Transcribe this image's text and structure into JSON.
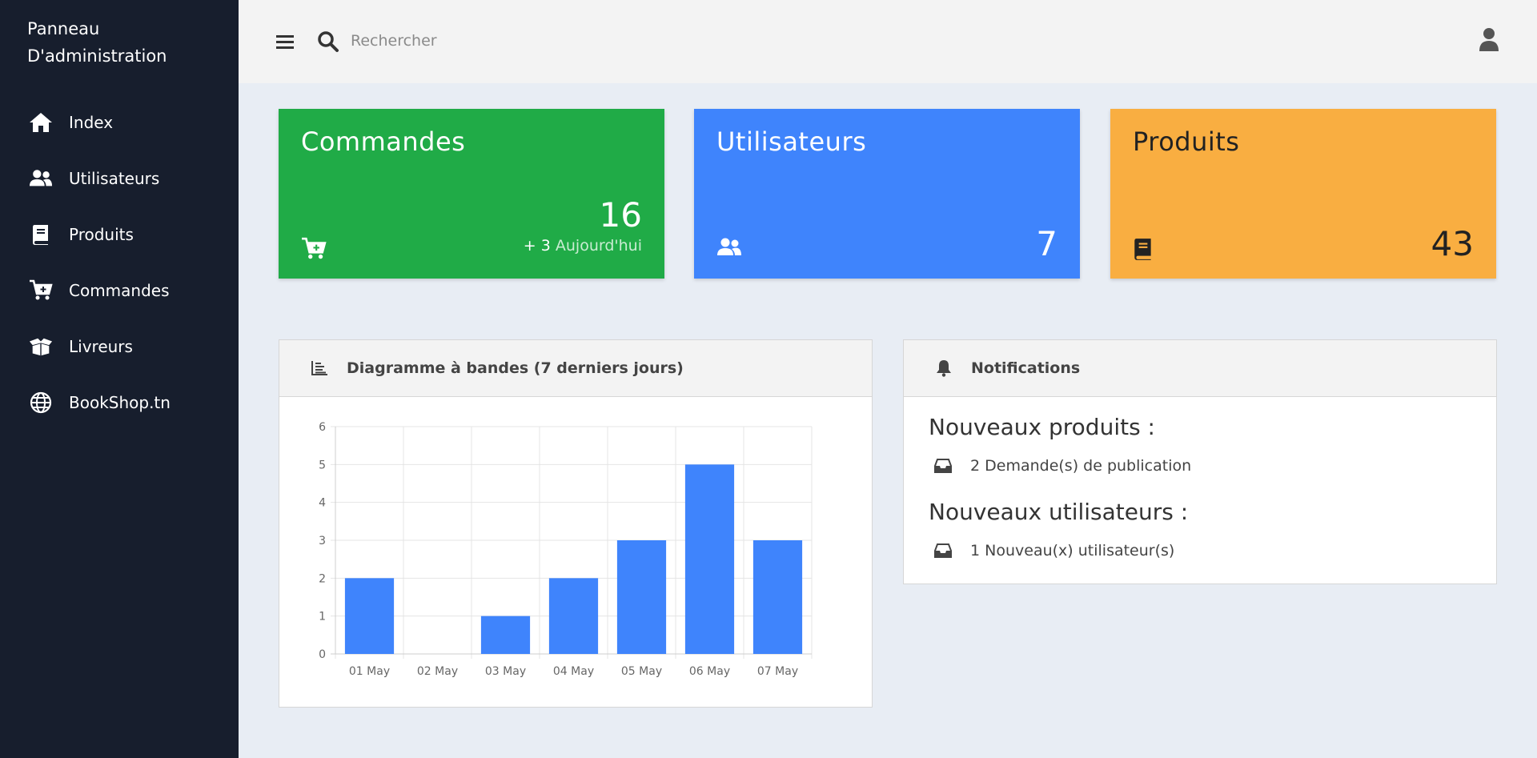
{
  "sidebar": {
    "brand_line1": "Panneau",
    "brand_line2": "D'administration",
    "items": [
      {
        "label": "Index",
        "icon": "home-icon"
      },
      {
        "label": "Utilisateurs",
        "icon": "users-icon"
      },
      {
        "label": "Produits",
        "icon": "book-icon"
      },
      {
        "label": "Commandes",
        "icon": "cart-plus-icon"
      },
      {
        "label": "Livreurs",
        "icon": "box-open-icon"
      },
      {
        "label": "BookShop.tn",
        "icon": "globe-icon"
      }
    ]
  },
  "topbar": {
    "search_placeholder": "Rechercher"
  },
  "cards": {
    "orders": {
      "title": "Commandes",
      "value": "16",
      "today_count": "+ 3",
      "today_label": "Aujourd'hui",
      "color": "#20ab47"
    },
    "users": {
      "title": "Utilisateurs",
      "value": "7",
      "color": "#3f84fc"
    },
    "products": {
      "title": "Produits",
      "value": "43",
      "color": "#f9ae41"
    }
  },
  "chart_panel": {
    "title": "Diagramme à bandes (7 derniers jours)"
  },
  "notifications": {
    "title": "Notifications",
    "sections": [
      {
        "heading": "Nouveaux produits :",
        "item": "2 Demande(s) de publication"
      },
      {
        "heading": "Nouveaux utilisateurs :",
        "item": "1 Nouveau(x) utilisateur(s)"
      }
    ]
  },
  "chart_data": {
    "type": "bar",
    "categories": [
      "01 May",
      "02 May",
      "03 May",
      "04 May",
      "05 May",
      "06 May",
      "07 May"
    ],
    "values": [
      2,
      0,
      1,
      2,
      3,
      5,
      3
    ],
    "ylim": [
      0,
      6
    ],
    "yticks": [
      0,
      1,
      2,
      3,
      4,
      5,
      6
    ],
    "grid": true,
    "bar_color": "#3f84fc"
  }
}
